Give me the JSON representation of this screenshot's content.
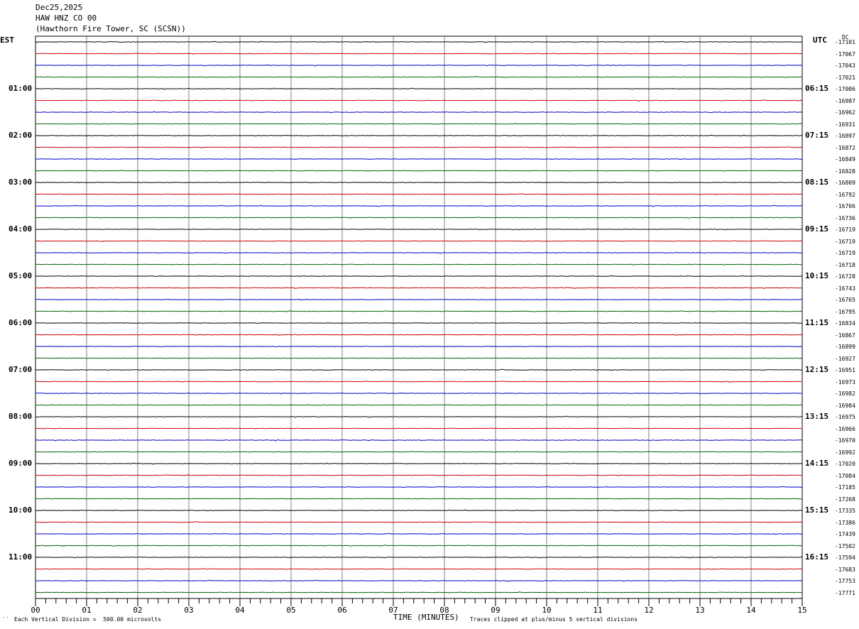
{
  "header": {
    "date": "Dec25,2025",
    "channel": "HAW HNZ CO 00",
    "station": "(Hawthorn Fire Tower, SC (SCSN))"
  },
  "left_axis_label": "EST",
  "right_axis_label": "UTC",
  "dc_label": "DC",
  "footer": {
    "scale_mark": "′′",
    "scale": "Each Vertical Division =  500.00 microvolts",
    "x_axis_title": "TIME (MINUTES)",
    "clip_note": "Traces clipped at plus/minus 5 vertical divisions"
  },
  "colors": {
    "series": [
      "#000000",
      "#cc0000",
      "#0000cc",
      "#006600"
    ],
    "grid": "#808080"
  },
  "chart_data": {
    "type": "line",
    "title": "",
    "xlabel": "TIME (MINUTES)",
    "ylabel": "",
    "xlim": [
      0,
      15
    ],
    "x_ticks": [
      "00",
      "01",
      "02",
      "03",
      "04",
      "05",
      "06",
      "07",
      "08",
      "09",
      "10",
      "11",
      "12",
      "13",
      "14",
      "15"
    ],
    "rows": 48,
    "row_minutes": 15,
    "est_labels": [
      "01:00",
      "02:00",
      "03:00",
      "04:00",
      "05:00",
      "06:00",
      "07:00",
      "08:00",
      "09:00",
      "10:00",
      "11:00"
    ],
    "utc_labels": [
      "06:15",
      "07:15",
      "08:15",
      "09:15",
      "10:15",
      "11:15",
      "12:15",
      "13:15",
      "14:15",
      "15:15",
      "16:15"
    ],
    "dc_offsets": [
      "-17101",
      "-17067",
      "-17043",
      "-17021",
      "-17006",
      "-16987",
      "-16962",
      "-16931",
      "-16897",
      "-16872",
      "-16849",
      "-16828",
      "-16809",
      "-16792",
      "-16766",
      "-16736",
      "-16719",
      "-16719",
      "-16719",
      "-16718",
      "-16728",
      "-16743",
      "-16765",
      "-16795",
      "-16834",
      "-16867",
      "-16899",
      "-16927",
      "-16951",
      "-16973",
      "-16982",
      "-16984",
      "-16975",
      "-16966",
      "-16970",
      "-16992",
      "-17020",
      "-17084",
      "-17185",
      "-17268",
      "-17335",
      "-17386",
      "-17439",
      "-17502",
      "-17594",
      "-17683",
      "-17753",
      "-17771"
    ]
  }
}
